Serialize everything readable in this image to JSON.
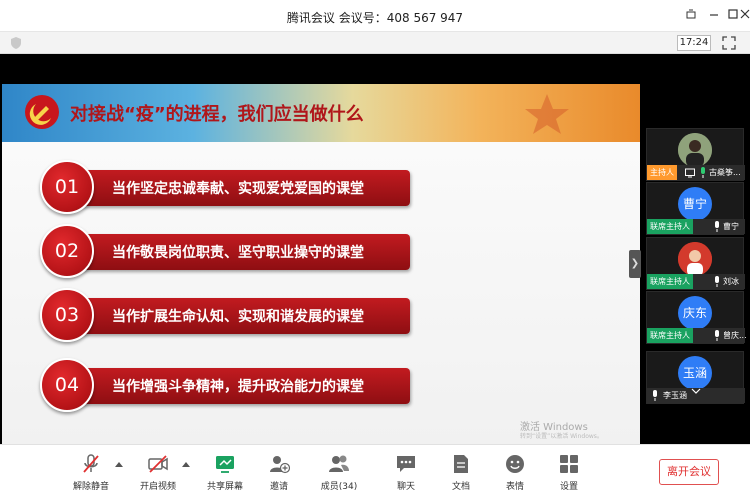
{
  "window": {
    "title": "腾讯会议  会议号：408 567 947"
  },
  "infobar": {
    "time": "17:24"
  },
  "slide": {
    "heading": "对接战“疫”的进程，我们应当做什么",
    "items": [
      {
        "num": "01",
        "text": "当作坚定忠诚奉献、实现爱党爱国的课堂"
      },
      {
        "num": "02",
        "text": "当作敬畏岗位职责、坚守职业操守的课堂"
      },
      {
        "num": "03",
        "text": "当作扩展生命认知、实现和谐发展的课堂"
      },
      {
        "num": "04",
        "text": "当作增强斗争精神，提升政治能力的课堂"
      }
    ],
    "watermark": {
      "line1": "激活 Windows",
      "line2": "转到“设置”以激活 Windows。"
    }
  },
  "participants": [
    {
      "avatar_text": "",
      "role": "主持人",
      "name": "古燊筝...",
      "avatar_color": "#7a8f6a",
      "sharing": true
    },
    {
      "avatar_text": "曹宁",
      "role": "联席主持人",
      "name": "曹宁",
      "avatar_color": "#2f7df6"
    },
    {
      "avatar_text": "",
      "role": "联席主持人",
      "name": "刘冰",
      "avatar_color": "#d33a2c"
    },
    {
      "avatar_text": "庆东",
      "role": "联席主持人",
      "name": "曾庆...",
      "avatar_color": "#2f7df6"
    },
    {
      "avatar_text": "玉涵",
      "role": "",
      "name": "李玉涵",
      "avatar_color": "#2f7df6"
    }
  ],
  "toolbar": {
    "unmute": "解除静音",
    "video": "开启视频",
    "share": "共享屏幕",
    "invite": "邀请",
    "members": "成员(34)",
    "chat": "聊天",
    "docs": "文档",
    "emoji": "表情",
    "settings": "设置",
    "leave": "离开会议"
  },
  "colors": {
    "accent_green": "#1aa260",
    "host_orange": "#ff9a2e",
    "slide_red": "#b51317",
    "leave_red": "#e03030"
  }
}
